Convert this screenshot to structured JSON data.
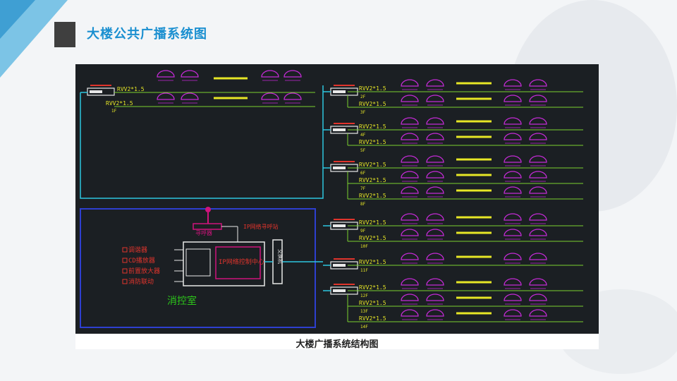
{
  "slide": {
    "title": "大楼公共广播系统图"
  },
  "diagram": {
    "caption": "大楼广播系统结构图",
    "room": {
      "label": "消控室"
    },
    "controller": {
      "label": "IP网络控制中心"
    },
    "switch": {
      "label": "交换机"
    },
    "call_station": {
      "label": "寻呼器"
    },
    "call_link": {
      "label": "IP网络寻呼站"
    },
    "sources": [
      "调谐器",
      "CD播放器",
      "前置放大器",
      "消防联动"
    ],
    "cable": "RVV2*1.5",
    "left_terminal": {
      "floor": "1F"
    },
    "terminals": [
      {
        "floors": [
          "2F",
          "3F"
        ]
      },
      {
        "floors": [
          "4F",
          "5F"
        ]
      },
      {
        "floors": [
          "6F",
          "7F",
          "8F"
        ]
      },
      {
        "floors": [
          "9F",
          "10F"
        ]
      },
      {
        "floors": [
          "11F"
        ]
      },
      {
        "floors": [
          "12F",
          "13F",
          "14F"
        ]
      }
    ]
  }
}
